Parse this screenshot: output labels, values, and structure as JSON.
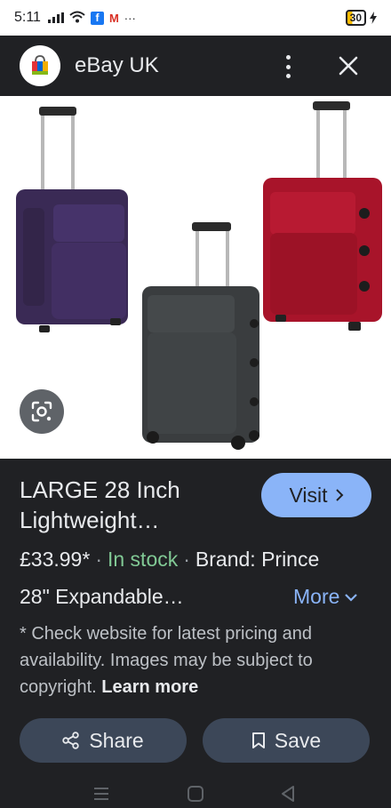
{
  "status_bar": {
    "time": "5:11",
    "icons": [
      "signal-icon",
      "wifi-icon",
      "facebook-icon",
      "gmail-icon",
      "more-notifications-icon"
    ],
    "overflow": "···",
    "battery": "30"
  },
  "header": {
    "site_name": "eBay UK",
    "icons": [
      "ebay-bag-icon",
      "more-vert-icon",
      "close-icon"
    ]
  },
  "product": {
    "title": "LARGE 28 Inch Lightweight…",
    "visit_label": "Visit",
    "price": "£33.99*",
    "stock": "In stock",
    "brand": "Brand: Prince",
    "separator": "·",
    "detail": "28\" Expandable…",
    "more_label": "More",
    "disclaimer": "* Check website for latest pricing and availability. Images may be subject to copyright.",
    "learn_more": "Learn more"
  },
  "actions": {
    "share_label": "Share",
    "save_label": "Save"
  },
  "colors": {
    "background": "#202124",
    "accent": "#8ab4f8",
    "stock_green": "#81c995",
    "button_bg": "#3c4758"
  }
}
